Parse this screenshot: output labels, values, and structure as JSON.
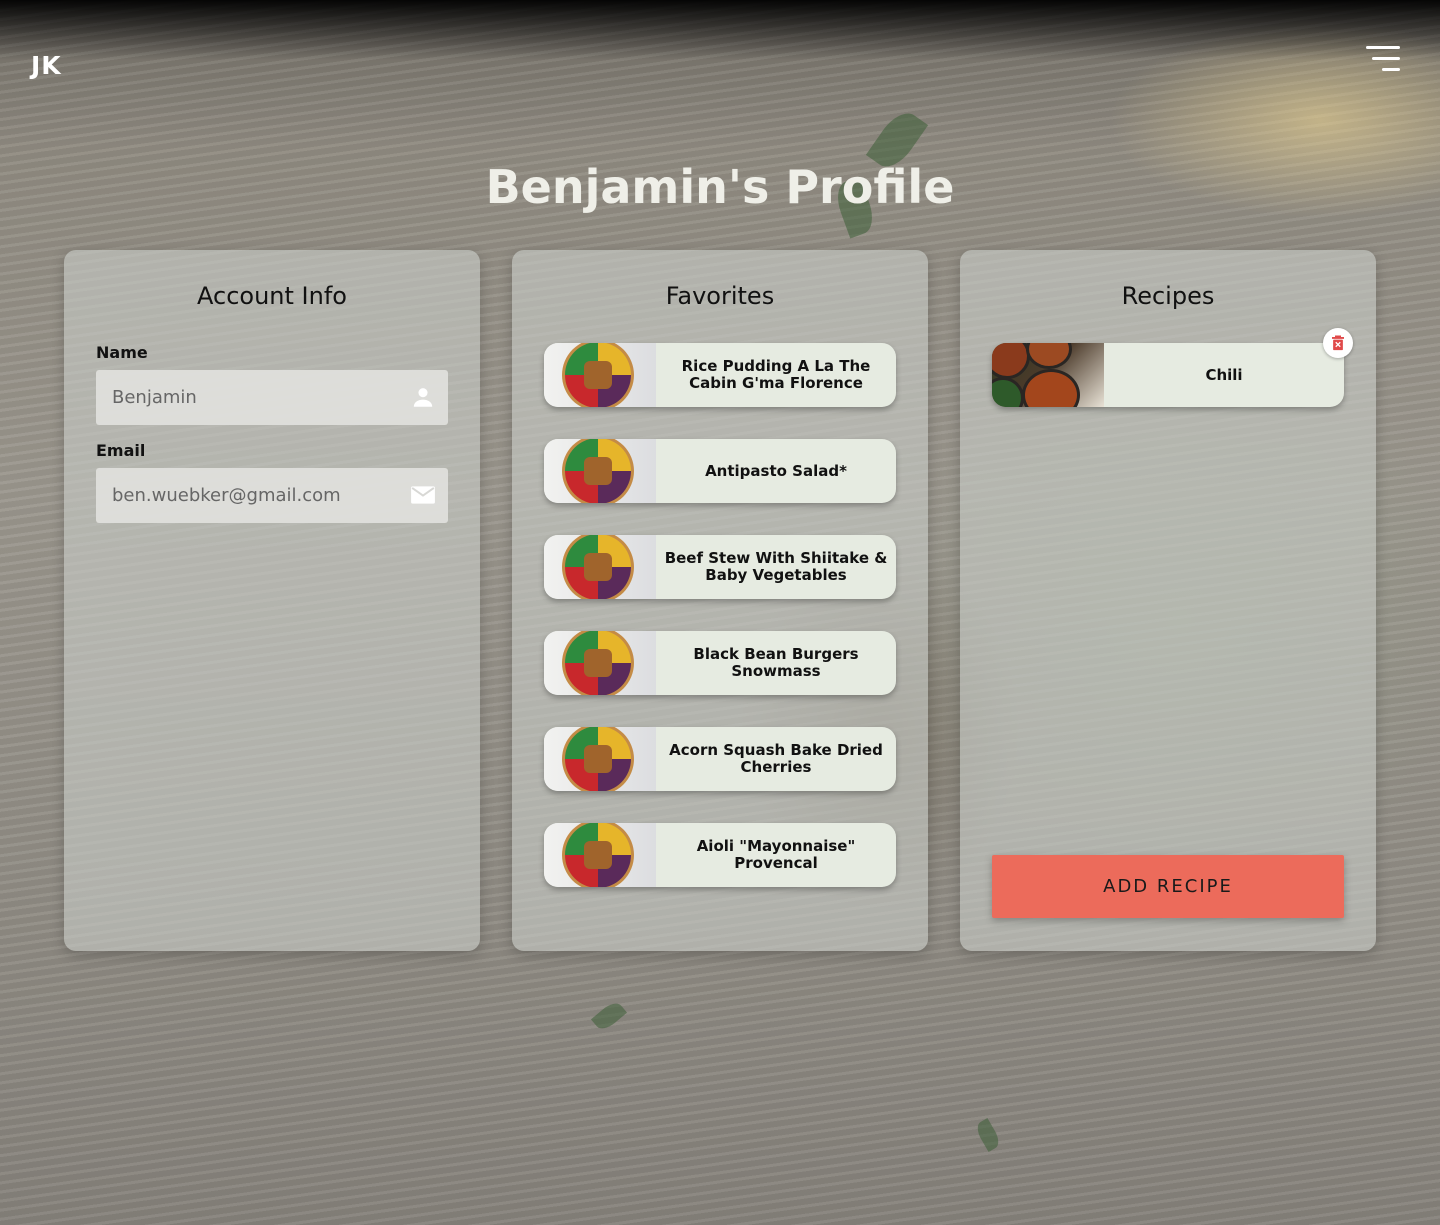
{
  "header": {
    "logo": "JK",
    "menu_icon": "hamburger-menu-icon"
  },
  "page": {
    "title": "Benjamin's Profile"
  },
  "account": {
    "title": "Account Info",
    "name_label": "Name",
    "name_value": "Benjamin",
    "name_icon": "person-icon",
    "email_label": "Email",
    "email_value": "ben.wuebker@gmail.com",
    "email_icon": "mail-icon"
  },
  "favorites": {
    "title": "Favorites",
    "items": [
      {
        "label": "Rice Pudding A La The Cabin G'ma Florence"
      },
      {
        "label": "Antipasto Salad*"
      },
      {
        "label": "Beef Stew With Shiitake & Baby Vegetables"
      },
      {
        "label": "Black Bean Burgers Snowmass"
      },
      {
        "label": "Acorn Squash Bake Dried Cherries"
      },
      {
        "label": "Aioli \"Mayonnaise\" Provencal"
      }
    ]
  },
  "recipes": {
    "title": "Recipes",
    "items": [
      {
        "label": "Chili"
      }
    ],
    "delete_icon": "trash-icon",
    "add_button": "ADD RECIPE"
  },
  "colors": {
    "accent": "#ec6b5b",
    "card_bg": "#c8ccc6",
    "item_bg": "#e6ebe1",
    "delete_red": "#e04a4a"
  }
}
